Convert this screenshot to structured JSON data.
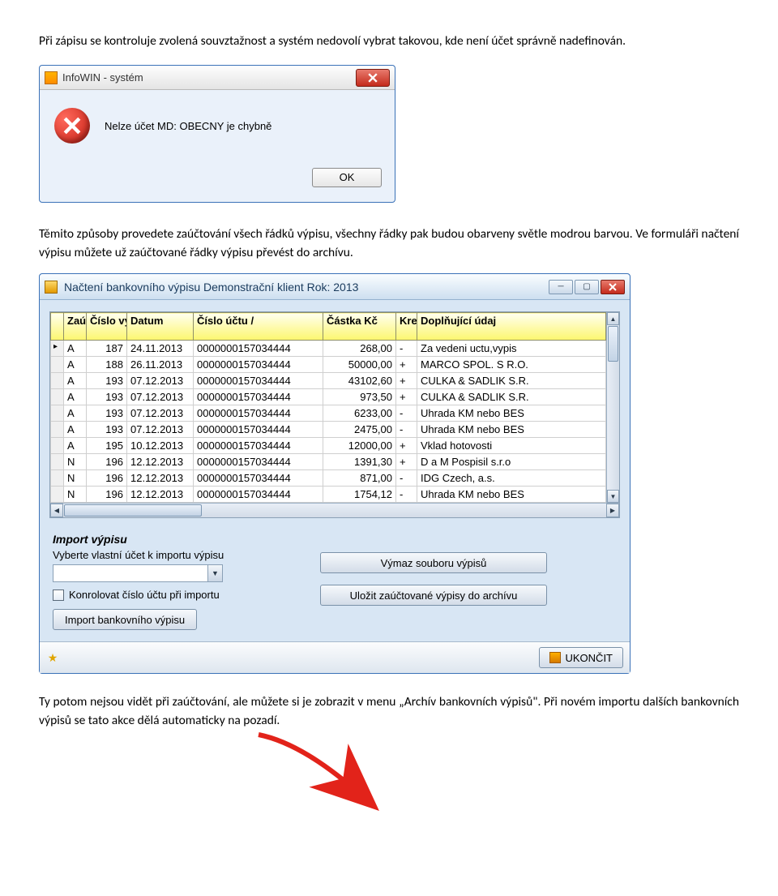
{
  "paragraphs": {
    "p1": "Při zápisu se kontroluje zvolená souvztažnost a systém nedovolí vybrat takovou, kde není účet správně nadefinován.",
    "p2": "Těmito způsoby provedete zaúčtování všech řádků výpisu, všechny řádky pak budou obarveny světle modrou barvou. Ve formuláři načtení výpisu můžete už zaúčtované řádky výpisu převést do archívu.",
    "p3": "Ty potom nejsou vidět při zaúčtování, ale můžete si je zobrazit v menu „Archív bankovních výpisů\". Při novém importu dalších bankovních výpisů se tato akce dělá automaticky na pozadí."
  },
  "dialog": {
    "title": "InfoWIN - systém",
    "message": "Nelze účet MD: OBECNY je chybně",
    "ok": "OK"
  },
  "mainwin": {
    "title": "Načtení bankovního výpisu  Demonstrační klient  Rok: 2013"
  },
  "columns": {
    "zau": "Zaú",
    "cislo_vypisu": "Číslo výpisu",
    "datum": "Datum",
    "cislo_uctu": "Číslo účtu /",
    "castka": "Částka Kč",
    "kre": "Kre",
    "dopl": "Doplňující údaj"
  },
  "rows": [
    {
      "zau": "A",
      "cv": "187",
      "dat": "24.11.2013",
      "uc": "0000000157034444",
      "kc": "268,00",
      "kr": "-",
      "d": "Za vedeni uctu,vypis"
    },
    {
      "zau": "A",
      "cv": "188",
      "dat": "26.11.2013",
      "uc": "0000000157034444",
      "kc": "50000,00",
      "kr": "+",
      "d": "MARCO SPOL. S R.O."
    },
    {
      "zau": "A",
      "cv": "193",
      "dat": "07.12.2013",
      "uc": "0000000157034444",
      "kc": "43102,60",
      "kr": "+",
      "d": "CULKA & SADLIK S.R."
    },
    {
      "zau": "A",
      "cv": "193",
      "dat": "07.12.2013",
      "uc": "0000000157034444",
      "kc": "973,50",
      "kr": "+",
      "d": "CULKA & SADLIK S.R."
    },
    {
      "zau": "A",
      "cv": "193",
      "dat": "07.12.2013",
      "uc": "0000000157034444",
      "kc": "6233,00",
      "kr": "-",
      "d": "Uhrada KM nebo BES"
    },
    {
      "zau": "A",
      "cv": "193",
      "dat": "07.12.2013",
      "uc": "0000000157034444",
      "kc": "2475,00",
      "kr": "-",
      "d": "Uhrada KM nebo BES"
    },
    {
      "zau": "A",
      "cv": "195",
      "dat": "10.12.2013",
      "uc": "0000000157034444",
      "kc": "12000,00",
      "kr": "+",
      "d": "Vklad hotovosti"
    },
    {
      "zau": "N",
      "cv": "196",
      "dat": "12.12.2013",
      "uc": "0000000157034444",
      "kc": "1391,30",
      "kr": "+",
      "d": "D a M Pospisil s.r.o"
    },
    {
      "zau": "N",
      "cv": "196",
      "dat": "12.12.2013",
      "uc": "0000000157034444",
      "kc": "871,00",
      "kr": "-",
      "d": "IDG Czech, a.s."
    },
    {
      "zau": "N",
      "cv": "196",
      "dat": "12.12.2013",
      "uc": "0000000157034444",
      "kc": "1754,12",
      "kr": "-",
      "d": "Uhrada KM nebo BES"
    }
  ],
  "import_panel": {
    "section": "Import výpisu",
    "hint": "Vyberte vlastní účet k importu výpisu",
    "checkbox": "Konrolovat číslo účtu při importu",
    "import_btn": "Import bankovního výpisu",
    "wipe_btn": "Výmaz souboru výpisů",
    "archive_btn": "Uložit zaúčtované výpisy do archívu"
  },
  "footer": {
    "exit": "UKONČIT"
  }
}
